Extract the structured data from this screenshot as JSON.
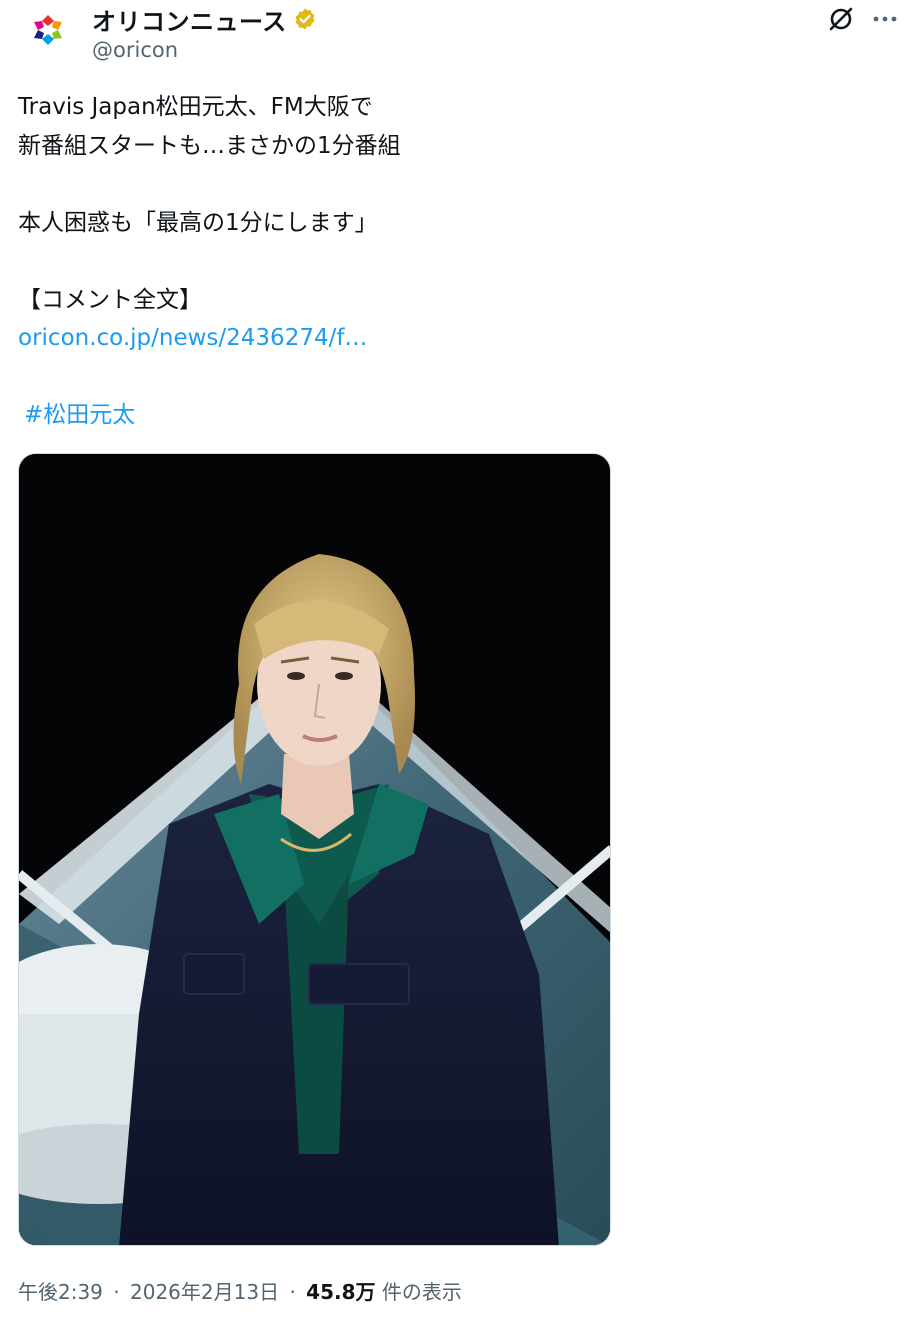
{
  "author": {
    "display_name": "オリコンニュース",
    "handle": "@oricon",
    "verified_color": "#e2b719",
    "avatar_text": "オリコンニュース"
  },
  "tweet": {
    "lines": [
      "Travis Japan松田元太、FM大阪で",
      "新番組スタートも…まさかの1分番組",
      "",
      "本人困惑も「最高の1分にします」",
      "",
      "【コメント全文】"
    ],
    "link": "oricon.co.jp/news/2436274/f…",
    "hashtag": "#松田元太"
  },
  "meta": {
    "time": "午後2:39",
    "date": "2026年2月13日",
    "dot": "·",
    "views_count": "45.8万",
    "views_label": "件の表示"
  },
  "icons": {
    "grok": "grok-icon",
    "more": "more-icon",
    "verified": "verified-badge-icon"
  },
  "colors": {
    "link": "#1d9bf0",
    "secondary_text": "#536471",
    "primary_text": "#0f1419"
  }
}
